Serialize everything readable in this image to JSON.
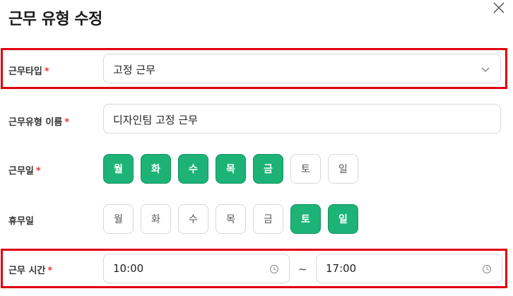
{
  "modal": {
    "title": "근무 유형 수정",
    "close_icon": "close-icon"
  },
  "work_type": {
    "label": "근무타입",
    "required_mark": "*",
    "value": "고정 근무"
  },
  "work_type_name": {
    "label": "근무유형 이름",
    "required_mark": "*",
    "value": "디자인팀 고정 근무"
  },
  "work_days": {
    "label": "근무일",
    "required_mark": "*",
    "days": [
      {
        "label": "월",
        "selected": true
      },
      {
        "label": "화",
        "selected": true
      },
      {
        "label": "수",
        "selected": true
      },
      {
        "label": "목",
        "selected": true
      },
      {
        "label": "금",
        "selected": true
      },
      {
        "label": "토",
        "selected": false
      },
      {
        "label": "일",
        "selected": false
      }
    ]
  },
  "off_days": {
    "label": "휴무일",
    "days": [
      {
        "label": "월",
        "selected": false
      },
      {
        "label": "화",
        "selected": false
      },
      {
        "label": "수",
        "selected": false
      },
      {
        "label": "목",
        "selected": false
      },
      {
        "label": "금",
        "selected": false
      },
      {
        "label": "토",
        "selected": true
      },
      {
        "label": "일",
        "selected": true
      }
    ]
  },
  "work_time": {
    "label": "근무 시간",
    "required_mark": "*",
    "start": "10:00",
    "separator": "~",
    "end": "17:00"
  },
  "colors": {
    "accent": "#1db377",
    "highlight": "#e0000f",
    "required": "#e53935"
  }
}
